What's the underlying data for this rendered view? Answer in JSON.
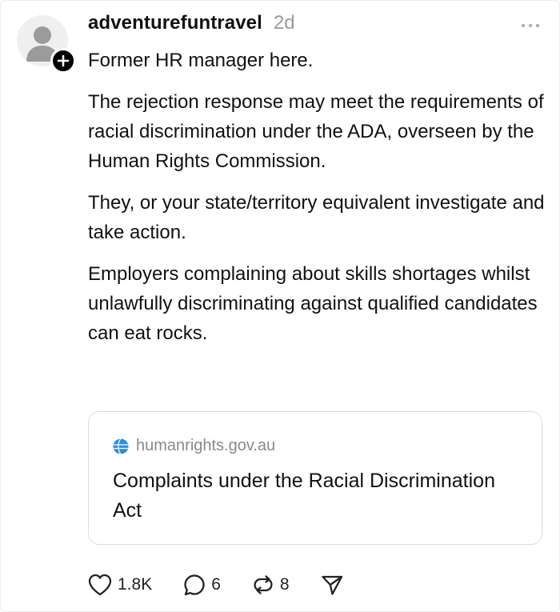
{
  "post": {
    "username": "adventurefuntravel",
    "timestamp": "2d",
    "paragraphs": [
      "Former HR manager here.",
      "The rejection response may meet the requirements of racial discrimination under the ADA, overseen by the Human Rights Commission.",
      "They, or your state/territory equivalent investigate and take action.",
      "Employers complaining about skills shortages whilst unlawfully discriminating against qualified candidates can eat rocks."
    ]
  },
  "link_card": {
    "domain": "humanrights.gov.au",
    "title": "Complaints under the Racial Discrimination Act"
  },
  "actions": {
    "like_count": "1.8K",
    "reply_count": "6",
    "repost_count": "8"
  },
  "icons": {
    "avatar": "default-person-avatar",
    "follow": "plus-icon",
    "more": "ellipsis-icon",
    "like": "heart-icon",
    "reply": "comment-icon",
    "repost": "repost-icon",
    "share": "send-icon",
    "site": "globe-icon"
  },
  "colors": {
    "text": "#111111",
    "muted": "#9a9a9a",
    "border": "#dcdcdc",
    "globe": "#2a8fd6"
  }
}
